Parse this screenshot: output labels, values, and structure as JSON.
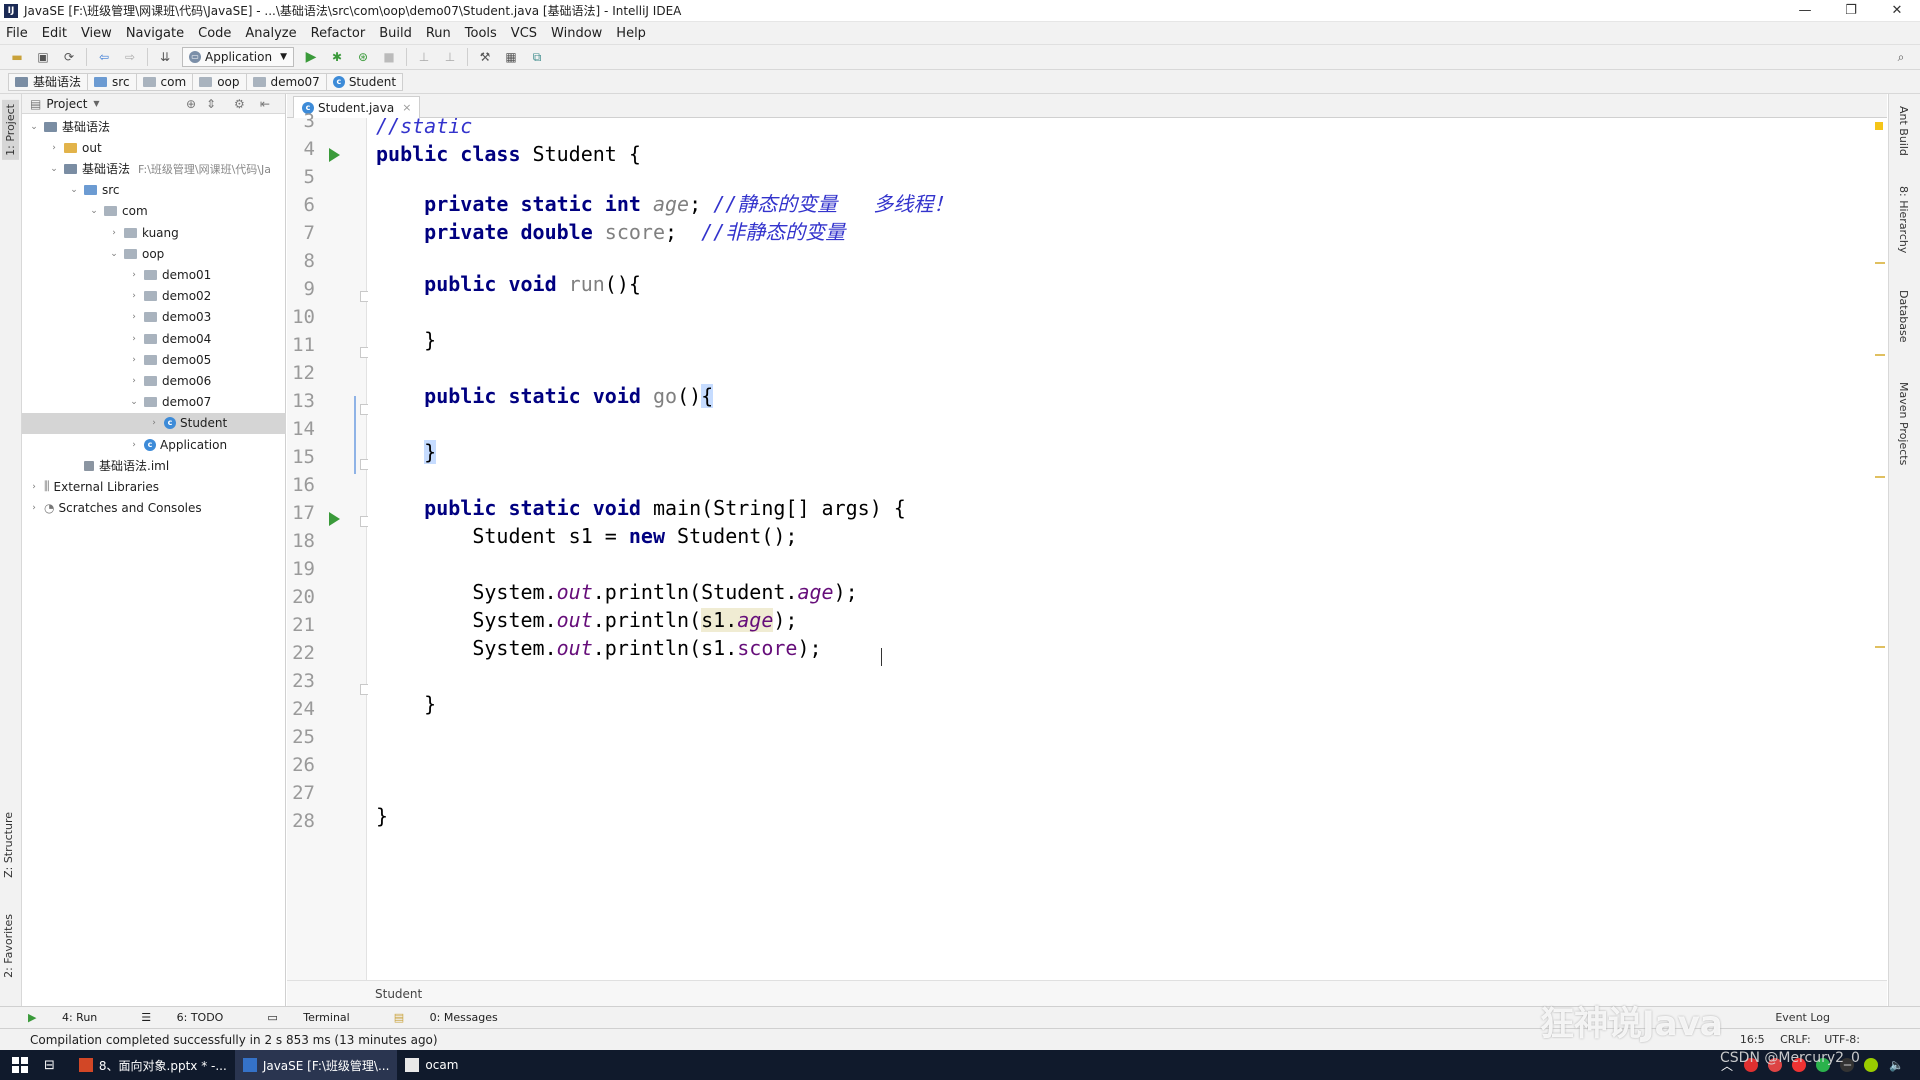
{
  "window": {
    "title": "JavaSE [F:\\班级管理\\网课班\\代码\\JavaSE] - ...\\基础语法\\src\\com\\oop\\demo07\\Student.java [基础语法] - IntelliJ IDEA",
    "min": "—",
    "max": "❐",
    "close": "✕"
  },
  "menu": [
    "File",
    "Edit",
    "View",
    "Navigate",
    "Code",
    "Analyze",
    "Refactor",
    "Build",
    "Run",
    "Tools",
    "VCS",
    "Window",
    "Help"
  ],
  "toolbar": {
    "run_config": "Application"
  },
  "breadcrumb": [
    "基础语法",
    "src",
    "com",
    "oop",
    "demo07",
    "Student"
  ],
  "left_tabs": {
    "project": "1: Project",
    "structure": "Z: Structure",
    "favorites": "2: Favorites"
  },
  "project": {
    "header": "Project",
    "tree": [
      {
        "label": "基础语法",
        "depth": 0,
        "arrow": "⌄",
        "kind": "module"
      },
      {
        "label": "out",
        "depth": 1,
        "arrow": "›",
        "kind": "folder-orange"
      },
      {
        "label": "基础语法",
        "extra": "F:\\班级管理\\网课班\\代码\\Ja",
        "depth": 1,
        "arrow": "⌄",
        "kind": "module"
      },
      {
        "label": "src",
        "depth": 2,
        "arrow": "⌄",
        "kind": "folder-blue"
      },
      {
        "label": "com",
        "depth": 3,
        "arrow": "⌄",
        "kind": "folder"
      },
      {
        "label": "kuang",
        "depth": 4,
        "arrow": "›",
        "kind": "folder"
      },
      {
        "label": "oop",
        "depth": 4,
        "arrow": "⌄",
        "kind": "folder"
      },
      {
        "label": "demo01",
        "depth": 5,
        "arrow": "›",
        "kind": "folder"
      },
      {
        "label": "demo02",
        "depth": 5,
        "arrow": "›",
        "kind": "folder"
      },
      {
        "label": "demo03",
        "depth": 5,
        "arrow": "›",
        "kind": "folder"
      },
      {
        "label": "demo04",
        "depth": 5,
        "arrow": "›",
        "kind": "folder"
      },
      {
        "label": "demo05",
        "depth": 5,
        "arrow": "›",
        "kind": "folder"
      },
      {
        "label": "demo06",
        "depth": 5,
        "arrow": "›",
        "kind": "folder"
      },
      {
        "label": "demo07",
        "depth": 5,
        "arrow": "⌄",
        "kind": "folder"
      },
      {
        "label": "Student",
        "depth": 6,
        "arrow": "›",
        "kind": "class",
        "selected": true
      },
      {
        "label": "Application",
        "depth": 5,
        "arrow": "›",
        "kind": "class"
      },
      {
        "label": "基础语法.iml",
        "depth": 2,
        "arrow": "",
        "kind": "file"
      },
      {
        "label": "External Libraries",
        "depth": 0,
        "arrow": "›",
        "kind": "lib"
      },
      {
        "label": "Scratches and Consoles",
        "depth": 0,
        "arrow": "›",
        "kind": "scratch"
      }
    ]
  },
  "editor": {
    "tab": "Student.java",
    "tab_close": "×",
    "footer": "Student",
    "line_numbers": [
      "3",
      "4",
      "5",
      "6",
      "7",
      "8",
      "9",
      "10",
      "11",
      "12",
      "13",
      "14",
      "15",
      "16",
      "17",
      "18",
      "19",
      "20",
      "21",
      "22",
      "23",
      "24",
      "25",
      "26",
      "27",
      "28"
    ]
  },
  "right_tabs": [
    "Ant Build",
    "8: Hierarchy",
    "Database",
    "Maven Projects"
  ],
  "bottom_tabs": [
    "4: Run",
    "6: TODO",
    "Terminal",
    "0: Messages"
  ],
  "status": {
    "message": "Compilation completed successfully in 2 s 853 ms (13 minutes ago)",
    "position": "16:5",
    "line_sep": "CRLF:",
    "encoding": "UTF-8:",
    "event_log": "Event Log"
  },
  "taskbar": {
    "tasks": [
      {
        "label": "8、面向对象.pptx * -...",
        "active": false
      },
      {
        "label": "JavaSE [F:\\班级管理\\...",
        "active": true
      },
      {
        "label": "ocam",
        "active": false
      }
    ]
  },
  "watermark": "狂神说Java",
  "csdn": "CSDN @Mercury2_0"
}
